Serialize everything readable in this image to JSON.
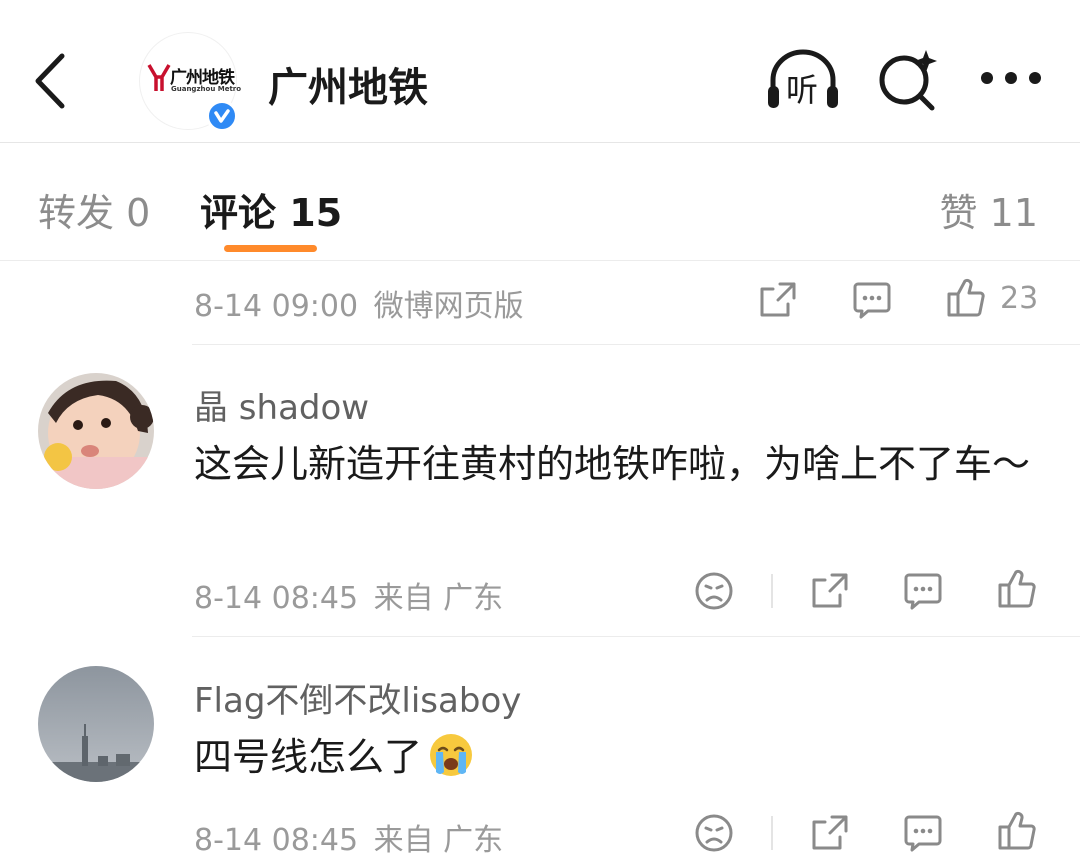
{
  "header": {
    "title": "广州地铁",
    "logo_cn": "广州地铁",
    "logo_en": "Guangzhou Metro",
    "listen_label": "听"
  },
  "tabs": [
    {
      "label": "转发",
      "count": "0"
    },
    {
      "label": "评论",
      "count": "15"
    },
    {
      "label": "赞",
      "count": "11"
    }
  ],
  "post_meta": {
    "time": "8-14 09:00",
    "source": "微博网页版",
    "like_count": "23"
  },
  "comments": [
    {
      "username": "晶 shadow",
      "text": "这会儿新造开往黄村的地铁咋啦，为啥上不了车～",
      "time": "8-14 08:45",
      "location": "来自 广东"
    },
    {
      "username": "Flag不倒不改lisaboy",
      "text": "四号线怎么了",
      "time": "8-14 08:45",
      "location": "来自 广东"
    }
  ],
  "colors": {
    "accent": "#ff8a2b",
    "verified": "#2f8af5",
    "muted": "#9a9a9a"
  }
}
